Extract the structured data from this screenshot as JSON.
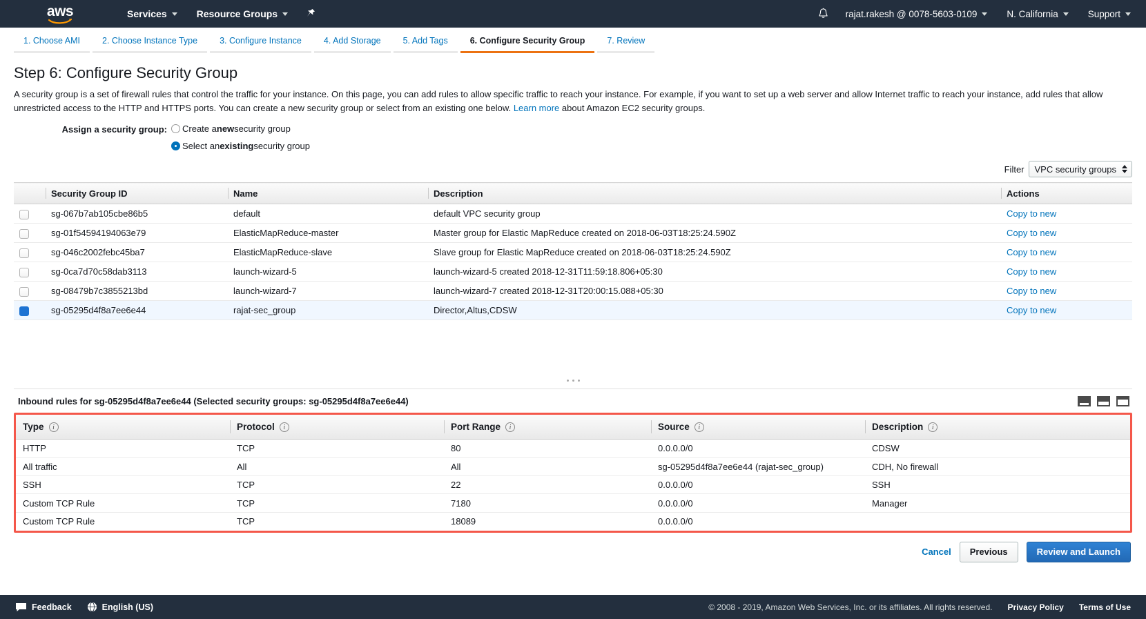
{
  "navbar": {
    "logo_text": "aws",
    "services_label": "Services",
    "resource_groups_label": "Resource Groups",
    "pin_icon": "pin-icon",
    "bell_icon": "bell-icon",
    "account_label": "rajat.rakesh @ 0078-5603-0109",
    "region_label": "N. California",
    "support_label": "Support"
  },
  "wizard": {
    "tabs": [
      {
        "label": "1. Choose AMI",
        "active": false
      },
      {
        "label": "2. Choose Instance Type",
        "active": false
      },
      {
        "label": "3. Configure Instance",
        "active": false
      },
      {
        "label": "4. Add Storage",
        "active": false
      },
      {
        "label": "5. Add Tags",
        "active": false
      },
      {
        "label": "6. Configure Security Group",
        "active": true
      },
      {
        "label": "7. Review",
        "active": false
      }
    ]
  },
  "page": {
    "title": "Step 6: Configure Security Group",
    "intro_part1": "A security group is a set of firewall rules that control the traffic for your instance. On this page, you can add rules to allow specific traffic to reach your instance. For example, if you want to set up a web server and allow Internet traffic to reach your instance, add rules that allow unrestricted access to the HTTP and HTTPS ports. You can create a new security group or select from an existing one below.",
    "intro_link": "Learn more",
    "intro_part2": "about Amazon EC2 security groups."
  },
  "assign": {
    "label": "Assign a security group:",
    "option_new_prefix": "Create a ",
    "option_new_bold": "new",
    "option_new_suffix": " security group",
    "option_existing_prefix": "Select an ",
    "option_existing_bold": "existing",
    "option_existing_suffix": " security group",
    "selected": "existing"
  },
  "filter": {
    "label": "Filter",
    "value": "VPC security groups"
  },
  "sg_table": {
    "columns": [
      "Security Group ID",
      "Name",
      "Description",
      "Actions"
    ],
    "action_label": "Copy to new",
    "rows": [
      {
        "id": "sg-067b7ab105cbe86b5",
        "name": "default",
        "description": "default VPC security group",
        "selected": false
      },
      {
        "id": "sg-01f54594194063e79",
        "name": "ElasticMapReduce-master",
        "description": "Master group for Elastic MapReduce created on 2018-06-03T18:25:24.590Z",
        "selected": false
      },
      {
        "id": "sg-046c2002febc45ba7",
        "name": "ElasticMapReduce-slave",
        "description": "Slave group for Elastic MapReduce created on 2018-06-03T18:25:24.590Z",
        "selected": false
      },
      {
        "id": "sg-0ca7d70c58dab3113",
        "name": "launch-wizard-5",
        "description": "launch-wizard-5 created 2018-12-31T11:59:18.806+05:30",
        "selected": false
      },
      {
        "id": "sg-08479b7c3855213bd",
        "name": "launch-wizard-7",
        "description": "launch-wizard-7 created 2018-12-31T20:00:15.088+05:30",
        "selected": false
      },
      {
        "id": "sg-05295d4f8a7ee6e44",
        "name": "rajat-sec_group",
        "description": "Director,Altus,CDSW",
        "selected": true
      }
    ]
  },
  "inbound": {
    "title": "Inbound rules for sg-05295d4f8a7ee6e44 (Selected security groups: sg-05295d4f8a7ee6e44)",
    "columns": [
      "Type",
      "Protocol",
      "Port Range",
      "Source",
      "Description"
    ],
    "rows": [
      {
        "type": "HTTP",
        "protocol": "TCP",
        "port": "80",
        "source": "0.0.0.0/0",
        "description": "CDSW"
      },
      {
        "type": "All traffic",
        "protocol": "All",
        "port": "All",
        "source": "sg-05295d4f8a7ee6e44 (rajat-sec_group)",
        "description": "CDH, No firewall"
      },
      {
        "type": "SSH",
        "protocol": "TCP",
        "port": "22",
        "source": "0.0.0.0/0",
        "description": "SSH"
      },
      {
        "type": "Custom TCP Rule",
        "protocol": "TCP",
        "port": "7180",
        "source": "0.0.0.0/0",
        "description": "Manager"
      },
      {
        "type": "Custom TCP Rule",
        "protocol": "TCP",
        "port": "18089",
        "source": "0.0.0.0/0",
        "description": ""
      }
    ]
  },
  "footer_actions": {
    "cancel": "Cancel",
    "previous": "Previous",
    "review_and_launch": "Review and Launch"
  },
  "bottombar": {
    "feedback": "Feedback",
    "language": "English (US)",
    "copyright": "© 2008 - 2019, Amazon Web Services, Inc. or its affiliates. All rights reserved.",
    "privacy": "Privacy Policy",
    "terms": "Terms of Use"
  },
  "colors": {
    "nav_bg": "#232f3e",
    "accent_orange": "#ec7211",
    "link_blue": "#0073bb",
    "highlight_red": "#f4574a",
    "primary_button": "#2269b5"
  }
}
